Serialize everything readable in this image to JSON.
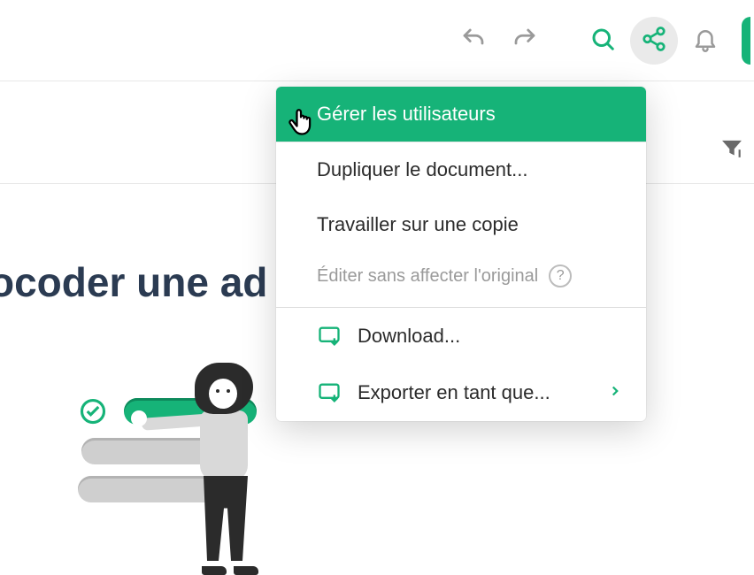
{
  "toolbar": {
    "undo_icon": "undo",
    "redo_icon": "redo",
    "search_icon": "search",
    "share_icon": "share",
    "bell_icon": "bell"
  },
  "heading": "ocoder une ad",
  "menu": {
    "manage_users": "Gérer les utilisateurs",
    "duplicate": "Dupliquer le document...",
    "work_on_copy": "Travailler sur une copie",
    "note": "Éditer sans affecter l'original",
    "note_help": "?",
    "download": "Download...",
    "export_as": "Exporter en tant que..."
  }
}
